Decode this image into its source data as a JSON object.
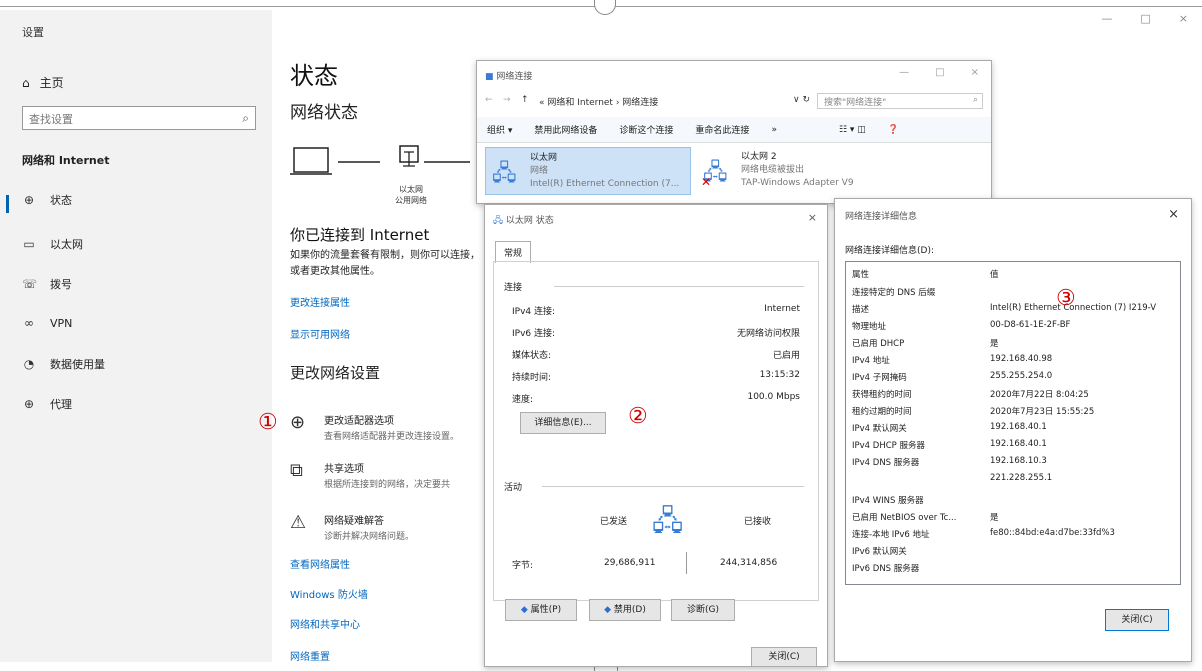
{
  "settings": {
    "title": "设置",
    "home": "主页",
    "search_placeholder": "查找设置",
    "section": "网络和 Internet",
    "nav": [
      {
        "icon": "globe-icon",
        "label": "状态"
      },
      {
        "icon": "ethernet-icon",
        "label": "以太网"
      },
      {
        "icon": "dialup-icon",
        "label": "拨号"
      },
      {
        "icon": "vpn-icon",
        "label": "VPN"
      },
      {
        "icon": "data-usage-icon",
        "label": "数据使用量"
      },
      {
        "icon": "proxy-icon",
        "label": "代理"
      }
    ],
    "win_controls": [
      "—",
      "□",
      "×"
    ]
  },
  "main": {
    "title": "状态",
    "network_status": "网络状态",
    "diagram_label_1": "以太网",
    "diagram_label_2": "公用网络",
    "connected_title": "你已连接到 Internet",
    "connected_desc": "如果你的流量套餐有限制，则你可以连接，或者更改其他属性。",
    "link_change_props": "更改连接属性",
    "link_show_networks": "显示可用网络",
    "change_title": "更改网络设置",
    "opt1_title": "更改适配器选项",
    "opt1_desc": "查看网络适配器并更改连接设置。",
    "opt2_title": "共享选项",
    "opt2_desc": "根据所连接到的网络，决定要共",
    "opt3_title": "网络疑难解答",
    "opt3_desc": "诊断并解决网络问题。",
    "link_view_props": "查看网络属性",
    "link_firewall": "Windows 防火墙",
    "link_sharing_center": "网络和共享中心",
    "link_reset": "网络重置"
  },
  "markers": {
    "m1": "①",
    "m2": "②",
    "m3": "③"
  },
  "netconn": {
    "title": "网络连接",
    "address": "« 网络和 Internet › 网络连接",
    "search_placeholder": "搜索\"网络连接\"",
    "toolbar": [
      "组织 ▾",
      "禁用此网络设备",
      "诊断这个连接",
      "重命名此连接",
      "»"
    ],
    "adapter1": {
      "name": "以太网",
      "status": "网络",
      "device": "Intel(R) Ethernet Connection (7..."
    },
    "adapter2": {
      "name": "以太网 2",
      "status": "网络电缆被拔出",
      "device": "TAP-Windows Adapter V9"
    }
  },
  "status": {
    "title": "以太网 状态",
    "tab": "常规",
    "connection_label": "连接",
    "rows": [
      {
        "k": "IPv4 连接:",
        "v": "Internet"
      },
      {
        "k": "IPv6 连接:",
        "v": "无网络访问权限"
      },
      {
        "k": "媒体状态:",
        "v": "已启用"
      },
      {
        "k": "持续时间:",
        "v": "13:15:32"
      },
      {
        "k": "速度:",
        "v": "100.0 Mbps"
      }
    ],
    "details_button": "详细信息(E)...",
    "activity_label": "活动",
    "sent_label": "已发送",
    "received_label": "已接收",
    "bytes_label": "字节:",
    "sent_bytes": "29,686,911",
    "received_bytes": "244,314,856",
    "btn_properties": "属性(P)",
    "btn_disable": "禁用(D)",
    "btn_diagnose": "诊断(G)",
    "btn_close": "关闭(C)"
  },
  "details": {
    "title": "网络连接详细信息",
    "caption": "网络连接详细信息(D):",
    "col_prop": "属性",
    "col_value": "值",
    "rows": [
      {
        "k": "连接特定的 DNS 后缀",
        "v": ""
      },
      {
        "k": "描述",
        "v": "Intel(R) Ethernet Connection (7) I219-V"
      },
      {
        "k": "物理地址",
        "v": "00-D8-61-1E-2F-BF"
      },
      {
        "k": "已启用 DHCP",
        "v": "是"
      },
      {
        "k": "IPv4 地址",
        "v": "192.168.40.98"
      },
      {
        "k": "IPv4 子网掩码",
        "v": "255.255.254.0"
      },
      {
        "k": "获得租约的时间",
        "v": "2020年7月22日 8:04:25"
      },
      {
        "k": "租约过期的时间",
        "v": "2020年7月23日 15:55:25"
      },
      {
        "k": "IPv4 默认网关",
        "v": "192.168.40.1"
      },
      {
        "k": "IPv4 DHCP 服务器",
        "v": "192.168.40.1"
      },
      {
        "k": "IPv4 DNS 服务器",
        "v": "192.168.10.3"
      },
      {
        "k": "",
        "v": "221.228.255.1"
      },
      {
        "k": "IPv4 WINS 服务器",
        "v": ""
      },
      {
        "k": "已启用 NetBIOS over Tc...",
        "v": "是"
      },
      {
        "k": "连接-本地 IPv6 地址",
        "v": "fe80::84bd:e4a:d7be:33fd%3"
      },
      {
        "k": "IPv6 默认网关",
        "v": ""
      },
      {
        "k": "IPv6 DNS 服务器",
        "v": ""
      }
    ],
    "btn_close": "关闭(C)"
  }
}
